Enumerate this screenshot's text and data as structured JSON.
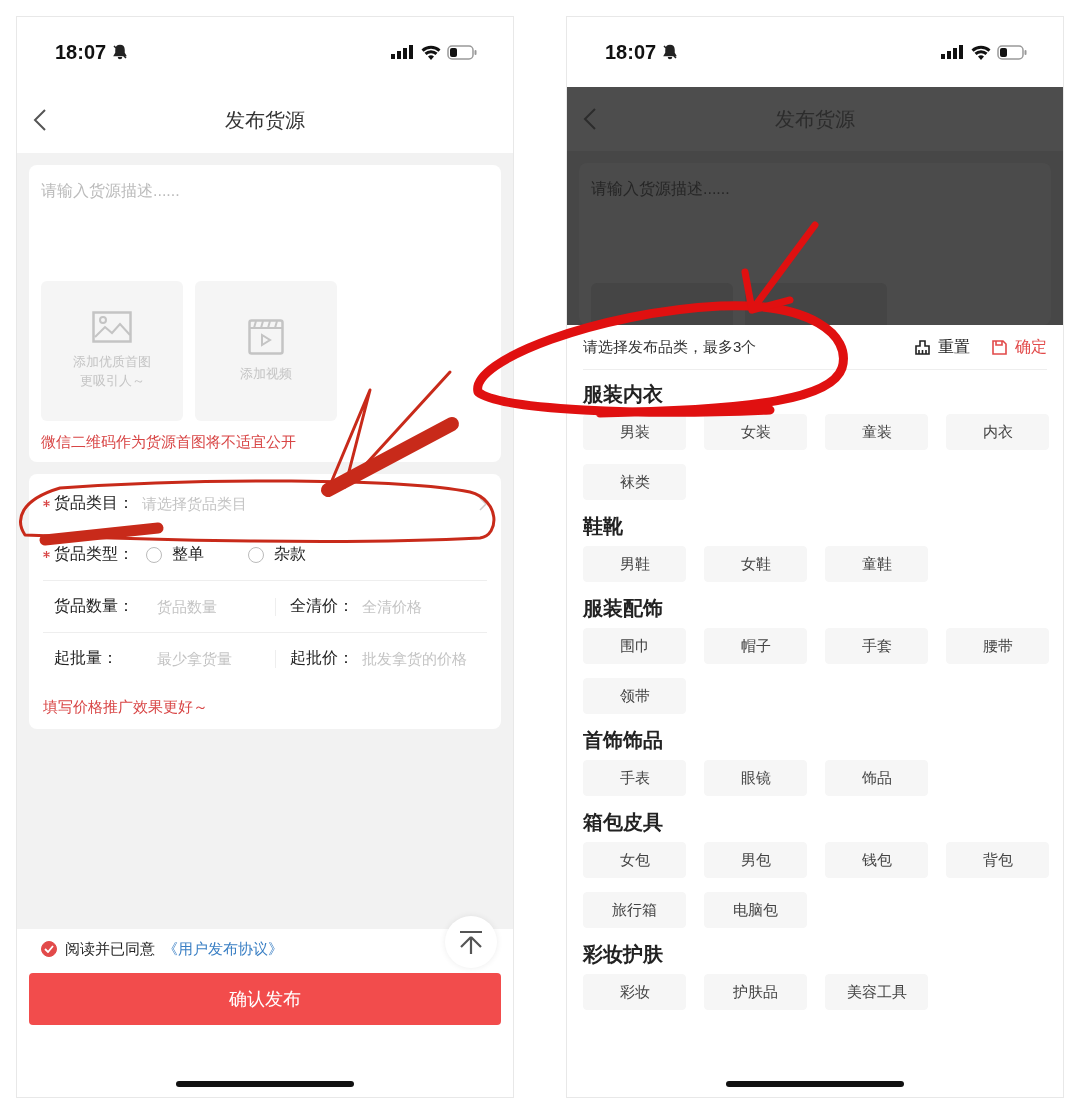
{
  "form_screen": {
    "status_bar": {
      "time": "18:07"
    },
    "nav": {
      "title": "发布货源"
    },
    "description": {
      "placeholder": "请输入货源描述......"
    },
    "upload_tiles": [
      {
        "kind": "image",
        "lines": [
          "添加优质首图",
          "更吸引人～"
        ]
      },
      {
        "kind": "video",
        "lines": [
          "添加视频"
        ]
      }
    ],
    "notice": "微信二维码作为货源首图将不适宜公开",
    "category_field": {
      "label": "货品类目：",
      "required": true,
      "placeholder": "请选择货品类目"
    },
    "type_field": {
      "label": "货品类型：",
      "required": true,
      "options": [
        {
          "label": "整单",
          "selected": false
        },
        {
          "label": "杂款",
          "selected": false
        }
      ]
    },
    "pair_rows": [
      {
        "left": {
          "label": "货品数量：",
          "placeholder": "货品数量"
        },
        "right": {
          "label": "全清价：",
          "placeholder": "全清价格"
        }
      },
      {
        "left": {
          "label": "起批量：",
          "placeholder": "最少拿货量"
        },
        "right": {
          "label": "起批价：",
          "placeholder": "批发拿货的价格"
        }
      }
    ],
    "hint": "填写价格推广效果更好～",
    "agreement": {
      "checked": true,
      "text": "阅读并已同意",
      "link": "《用户发布协议》"
    },
    "submit": "确认发布"
  },
  "category_screen": {
    "status_bar": {
      "time": "18:07"
    },
    "background": {
      "title": "发布货源",
      "placeholder": "请输入货源描述......"
    },
    "sheet": {
      "prompt": "请选择发布品类，最多3个",
      "reset": "重置",
      "confirm": "确定",
      "sections": [
        {
          "title": "服装内衣",
          "items": [
            {
              "label": "男装",
              "selected": false
            },
            {
              "label": "女装",
              "selected": false
            },
            {
              "label": "童装",
              "selected": false
            },
            {
              "label": "内衣",
              "selected": false
            },
            {
              "label": "袜类",
              "selected": false
            }
          ]
        },
        {
          "title": "鞋靴",
          "items": [
            {
              "label": "男鞋",
              "selected": false
            },
            {
              "label": "女鞋",
              "selected": false
            },
            {
              "label": "童鞋",
              "selected": false
            }
          ]
        },
        {
          "title": "服装配饰",
          "items": [
            {
              "label": "围巾",
              "selected": false
            },
            {
              "label": "帽子",
              "selected": false
            },
            {
              "label": "手套",
              "selected": false
            },
            {
              "label": "腰带",
              "selected": false
            },
            {
              "label": "领带",
              "selected": false
            }
          ]
        },
        {
          "title": "首饰饰品",
          "items": [
            {
              "label": "手表",
              "selected": false
            },
            {
              "label": "眼镜",
              "selected": false
            },
            {
              "label": "饰品",
              "selected": false
            }
          ]
        },
        {
          "title": "箱包皮具",
          "items": [
            {
              "label": "女包",
              "selected": false
            },
            {
              "label": "男包",
              "selected": false
            },
            {
              "label": "钱包",
              "selected": false
            },
            {
              "label": "背包",
              "selected": false
            },
            {
              "label": "旅行箱",
              "selected": false
            },
            {
              "label": "电脑包",
              "selected": false
            }
          ]
        },
        {
          "title": "彩妆护肤",
          "items": [
            {
              "label": "彩妆",
              "selected": false
            },
            {
              "label": "护肤品",
              "selected": false
            },
            {
              "label": "美容工具",
              "selected": false
            }
          ]
        }
      ]
    }
  }
}
